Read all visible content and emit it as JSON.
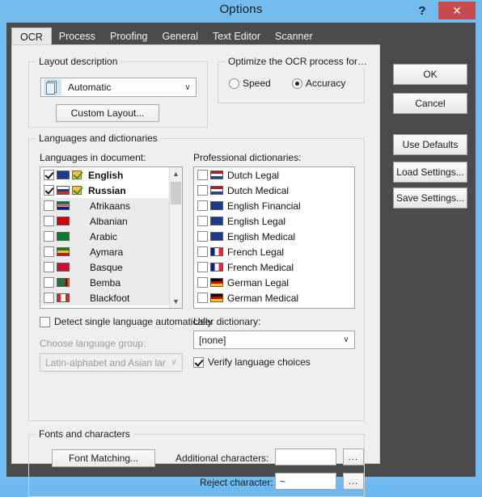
{
  "window": {
    "title": "Options",
    "help_label": "?",
    "close_label": "✕",
    "accent_color": "#72bcf0",
    "close_color": "#c9494d",
    "chrome_color": "#4b4b4b"
  },
  "tabs": [
    {
      "label": "OCR",
      "active": true
    },
    {
      "label": "Process",
      "active": false
    },
    {
      "label": "Proofing",
      "active": false
    },
    {
      "label": "General",
      "active": false
    },
    {
      "label": "Text Editor",
      "active": false
    },
    {
      "label": "Scanner",
      "active": false
    }
  ],
  "layout_group": {
    "title": "Layout description",
    "combo_value": "Automatic",
    "chevron": "∨",
    "custom_layout_button": "Custom Layout..."
  },
  "optimize_group": {
    "title": "Optimize the OCR process for…",
    "options": [
      {
        "label": "Speed",
        "selected": false
      },
      {
        "label": "Accuracy",
        "selected": true
      }
    ]
  },
  "languages_group": {
    "title": "Languages and dictionaries",
    "languages_label": "Languages in document:",
    "dictionaries_label": "Professional dictionaries:",
    "languages": [
      {
        "label": "English",
        "checked": true,
        "selected": true,
        "flag": "gb",
        "dictionary": true
      },
      {
        "label": "Russian",
        "checked": true,
        "selected": true,
        "flag": "ru",
        "dictionary": true
      },
      {
        "label": "Afrikaans",
        "checked": false,
        "selected": false,
        "flag": "za",
        "dictionary": false
      },
      {
        "label": "Albanian",
        "checked": false,
        "selected": false,
        "flag": "al",
        "dictionary": false
      },
      {
        "label": "Arabic",
        "checked": false,
        "selected": false,
        "flag": "ar",
        "dictionary": false
      },
      {
        "label": "Aymara",
        "checked": false,
        "selected": false,
        "flag": "aym",
        "dictionary": false
      },
      {
        "label": "Basque",
        "checked": false,
        "selected": false,
        "flag": "eus",
        "dictionary": false
      },
      {
        "label": "Bemba",
        "checked": false,
        "selected": false,
        "flag": "zm",
        "dictionary": false
      },
      {
        "label": "Blackfoot",
        "checked": false,
        "selected": false,
        "flag": "ca",
        "dictionary": false
      }
    ],
    "dictionaries": [
      {
        "label": "Dutch Legal",
        "checked": false,
        "flag": "nl"
      },
      {
        "label": "Dutch Medical",
        "checked": false,
        "flag": "nl"
      },
      {
        "label": "English Financial",
        "checked": false,
        "flag": "gb"
      },
      {
        "label": "English Legal",
        "checked": false,
        "flag": "gb"
      },
      {
        "label": "English Medical",
        "checked": false,
        "flag": "gb"
      },
      {
        "label": "French Legal",
        "checked": false,
        "flag": "fr"
      },
      {
        "label": "French Medical",
        "checked": false,
        "flag": "fr"
      },
      {
        "label": "German Legal",
        "checked": false,
        "flag": "de"
      },
      {
        "label": "German Medical",
        "checked": false,
        "flag": "de"
      }
    ],
    "detect_single_language": {
      "label": "Detect single language automatically",
      "checked": false
    },
    "choose_group_label": "Choose language group:",
    "choose_group_value": "Latin-alphabet and Asian languages",
    "user_dictionary_label": "User dictionary:",
    "user_dictionary_value": "[none]",
    "verify_language_choices": {
      "label": "Verify language choices",
      "checked": true
    }
  },
  "fonts_group": {
    "title": "Fonts and characters",
    "font_matching_button": "Font Matching...",
    "additional_characters_label": "Additional characters:",
    "additional_characters_value": "",
    "reject_character_label": "Reject character:",
    "reject_character_value": "~",
    "browse_label": "..."
  },
  "side_buttons": [
    {
      "label": "OK"
    },
    {
      "label": "Cancel"
    },
    {
      "label": "Use Defaults"
    },
    {
      "label": "Load Settings..."
    },
    {
      "label": "Save Settings..."
    }
  ]
}
